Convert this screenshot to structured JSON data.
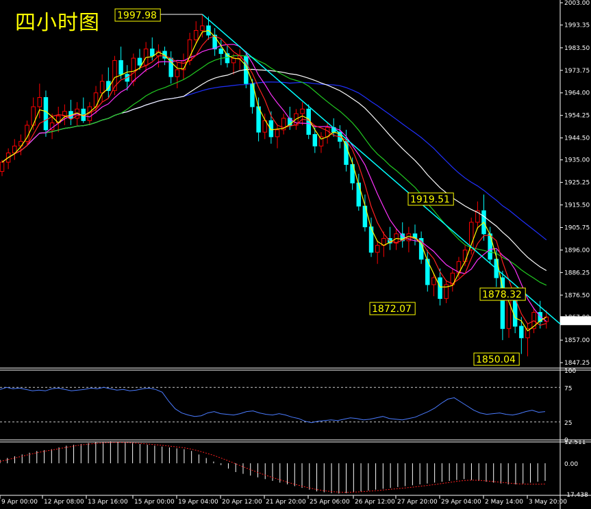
{
  "title": "四小时图",
  "colors": {
    "background": "#000000",
    "bull_candle": "#000000",
    "bull_outline": "#00ffff",
    "bear_candle": "#00ffff",
    "wick_up": "#ff0000",
    "ma5": "#ffff00",
    "ma10": "#ff2020",
    "ma20": "#ff33ff",
    "ma60": "#22cc22",
    "ma120": "#ffffff",
    "ma200": "#2030ff",
    "trendline": "#00ffff",
    "rsi": "#4a7bff",
    "macd_hist": "#ffffff",
    "macd_signal": "#ff2020",
    "annotation": "#ffff00"
  },
  "chart_data": {
    "type": "candlestick",
    "y_ticks": [
      "2003.00",
      "1993.35",
      "1983.50",
      "1973.75",
      "1964.00",
      "1954.25",
      "1944.50",
      "1935.00",
      "1925.25",
      "1915.50",
      "1905.75",
      "1896.00",
      "1886.25",
      "1876.50",
      "1867.00",
      "1857.00",
      "1847.25"
    ],
    "ylim": [
      1845.5,
      2003.0
    ],
    "last_price": "1865.41",
    "x_ticks": [
      "9 Apr 00:00",
      "12 Apr 08:00",
      "13 Apr 16:00",
      "15 Apr 00:00",
      "19 Apr 04:00",
      "20 Apr 12:00",
      "21 Apr 20:00",
      "25 Apr 06:00",
      "26 Apr 12:00",
      "27 Apr 20:00",
      "29 Apr 04:00",
      "2 May 14:00",
      "3 May 20:00"
    ],
    "annotations": [
      "1997.98",
      "1919.51",
      "1872.07",
      "1878.32",
      "1850.04"
    ],
    "candles": [
      [
        1930,
        1935,
        1928,
        1934
      ],
      [
        1934,
        1940,
        1931,
        1938
      ],
      [
        1938,
        1944,
        1935,
        1941
      ],
      [
        1941,
        1946,
        1937,
        1943
      ],
      [
        1943,
        1952,
        1941,
        1950
      ],
      [
        1950,
        1962,
        1948,
        1958
      ],
      [
        1958,
        1968,
        1953,
        1962
      ],
      [
        1962,
        1965,
        1945,
        1948
      ],
      [
        1948,
        1955,
        1944,
        1951
      ],
      [
        1951,
        1958,
        1947,
        1954
      ],
      [
        1954,
        1959,
        1950,
        1956
      ],
      [
        1956,
        1961,
        1950,
        1953
      ],
      [
        1953,
        1960,
        1950,
        1957
      ],
      [
        1957,
        1962,
        1951,
        1952
      ],
      [
        1952,
        1960,
        1950,
        1958
      ],
      [
        1958,
        1967,
        1955,
        1964
      ],
      [
        1964,
        1972,
        1960,
        1969
      ],
      [
        1969,
        1975,
        1962,
        1965
      ],
      [
        1965,
        1980,
        1963,
        1978
      ],
      [
        1978,
        1984,
        1970,
        1972
      ],
      [
        1972,
        1976,
        1965,
        1969
      ],
      [
        1969,
        1981,
        1967,
        1979
      ],
      [
        1979,
        1983,
        1974,
        1976
      ],
      [
        1976,
        1986,
        1973,
        1983
      ],
      [
        1983,
        1988,
        1978,
        1980
      ],
      [
        1980,
        1985,
        1975,
        1982
      ],
      [
        1982,
        1984,
        1976,
        1979
      ],
      [
        1979,
        1982,
        1968,
        1971
      ],
      [
        1971,
        1977,
        1966,
        1974
      ],
      [
        1974,
        1981,
        1970,
        1978
      ],
      [
        1978,
        1990,
        1976,
        1987
      ],
      [
        1987,
        1995,
        1985,
        1991
      ],
      [
        1991,
        1998,
        1988,
        1993
      ],
      [
        1993,
        1997,
        1987,
        1989
      ],
      [
        1989,
        1992,
        1980,
        1983
      ],
      [
        1983,
        1987,
        1976,
        1981
      ],
      [
        1981,
        1985,
        1975,
        1977
      ],
      [
        1977,
        1981,
        1972,
        1979
      ],
      [
        1979,
        1983,
        1974,
        1980
      ],
      [
        1980,
        1982,
        1966,
        1968
      ],
      [
        1968,
        1970,
        1955,
        1958
      ],
      [
        1958,
        1962,
        1943,
        1947
      ],
      [
        1947,
        1955,
        1944,
        1952
      ],
      [
        1952,
        1956,
        1942,
        1945
      ],
      [
        1945,
        1950,
        1940,
        1948
      ],
      [
        1948,
        1955,
        1946,
        1953
      ],
      [
        1953,
        1958,
        1948,
        1950
      ],
      [
        1950,
        1957,
        1948,
        1955
      ],
      [
        1955,
        1960,
        1950,
        1957
      ],
      [
        1957,
        1959,
        1944,
        1946
      ],
      [
        1946,
        1949,
        1938,
        1941
      ],
      [
        1941,
        1947,
        1938,
        1945
      ],
      [
        1945,
        1951,
        1942,
        1949
      ],
      [
        1949,
        1953,
        1945,
        1947
      ],
      [
        1947,
        1950,
        1940,
        1943
      ],
      [
        1943,
        1948,
        1930,
        1933
      ],
      [
        1933,
        1936,
        1922,
        1925
      ],
      [
        1925,
        1929,
        1913,
        1915
      ],
      [
        1915,
        1920,
        1904,
        1906
      ],
      [
        1906,
        1910,
        1893,
        1895
      ],
      [
        1895,
        1900,
        1890,
        1898
      ],
      [
        1898,
        1904,
        1893,
        1901
      ],
      [
        1901,
        1906,
        1896,
        1899
      ],
      [
        1899,
        1905,
        1896,
        1903
      ],
      [
        1903,
        1908,
        1897,
        1900
      ],
      [
        1900,
        1906,
        1895,
        1903
      ],
      [
        1903,
        1907,
        1898,
        1901
      ],
      [
        1901,
        1904,
        1890,
        1892
      ],
      [
        1892,
        1896,
        1878,
        1881
      ],
      [
        1881,
        1886,
        1876,
        1884
      ],
      [
        1884,
        1888,
        1872,
        1875
      ],
      [
        1875,
        1883,
        1873,
        1881
      ],
      [
        1881,
        1888,
        1878,
        1886
      ],
      [
        1886,
        1893,
        1884,
        1891
      ],
      [
        1891,
        1898,
        1889,
        1896
      ],
      [
        1896,
        1910,
        1894,
        1908
      ],
      [
        1908,
        1917,
        1905,
        1913
      ],
      [
        1913,
        1920,
        1900,
        1903
      ],
      [
        1903,
        1906,
        1890,
        1892
      ],
      [
        1892,
        1896,
        1880,
        1884
      ],
      [
        1884,
        1887,
        1857,
        1862
      ],
      [
        1862,
        1878,
        1858,
        1875
      ],
      [
        1875,
        1879,
        1860,
        1863
      ],
      [
        1863,
        1867,
        1851,
        1858
      ],
      [
        1858,
        1864,
        1850,
        1862
      ],
      [
        1862,
        1871,
        1860,
        1869
      ],
      [
        1869,
        1874,
        1862,
        1865
      ],
      [
        1865,
        1870,
        1862,
        1867
      ]
    ],
    "rsi": {
      "ylim": [
        0,
        100
      ],
      "ticks": [
        "100",
        "75",
        "25",
        "0"
      ],
      "values": [
        72,
        75,
        73,
        74,
        72,
        70,
        71,
        70,
        73,
        74,
        72,
        70,
        71,
        72,
        74,
        73,
        75,
        73,
        71,
        72,
        70,
        71,
        73,
        74,
        72,
        68,
        55,
        44,
        38,
        35,
        33,
        34,
        38,
        40,
        37,
        36,
        35,
        37,
        40,
        41,
        38,
        36,
        35,
        37,
        35,
        32,
        30,
        26,
        24,
        26,
        27,
        28,
        27,
        29,
        31,
        30,
        28,
        29,
        31,
        33,
        30,
        29,
        28,
        30,
        32,
        36,
        40,
        45,
        52,
        58,
        60,
        54,
        48,
        42,
        38,
        36,
        37,
        38,
        36,
        35,
        37,
        40,
        42,
        39,
        40
      ]
    },
    "macd": {
      "ticks": [
        "12.511",
        "0.00",
        "-17.438"
      ],
      "ylim": [
        -17.438,
        12.511
      ],
      "hist": [
        2,
        3,
        4,
        5,
        6,
        7,
        7.5,
        8,
        9,
        10,
        10.5,
        11,
        11.5,
        12,
        12.3,
        12.5,
        12.2,
        12,
        11.5,
        11,
        10.5,
        10,
        9.5,
        9,
        8.5,
        8,
        7,
        5,
        3,
        1,
        -1,
        -3,
        -5,
        -6,
        -7,
        -8,
        -9,
        -10,
        -11,
        -12,
        -13,
        -14,
        -15,
        -16,
        -16.5,
        -17,
        -17.2,
        -17,
        -16.5,
        -16,
        -15.5,
        -15,
        -14.5,
        -14,
        -13.5,
        -13,
        -12.5,
        -12,
        -11.5,
        -11,
        -10.5,
        -10,
        -9.5,
        -9,
        -9.5,
        -10,
        -10.5,
        -11,
        -11.5,
        -12,
        -12,
        -11.5,
        -11,
        -10.5,
        -10
      ],
      "signal": [
        1,
        2,
        3,
        4,
        5,
        6,
        6.8,
        7.5,
        8.3,
        9,
        9.8,
        10.4,
        10.9,
        11.3,
        11.6,
        11.8,
        11.9,
        11.8,
        11.6,
        11.3,
        11,
        10.6,
        10.2,
        9.8,
        9.3,
        8.8,
        8,
        7,
        5.8,
        4.5,
        3,
        1.4,
        -0.3,
        -2,
        -3.6,
        -5.2,
        -6.7,
        -8.1,
        -9.4,
        -10.7,
        -11.9,
        -13,
        -14,
        -14.9,
        -15.6,
        -16.1,
        -16.4,
        -16.5,
        -16.4,
        -16.2,
        -15.9,
        -15.6,
        -15.2,
        -14.8,
        -14.4,
        -14,
        -13.6,
        -13.1,
        -12.6,
        -12.1,
        -11.5,
        -10.9,
        -10.3,
        -9.8,
        -9.6,
        -9.7,
        -10,
        -10.4,
        -10.8,
        -11.2,
        -11.6,
        -11.8,
        -11.9,
        -11.9,
        -11.8
      ]
    }
  }
}
